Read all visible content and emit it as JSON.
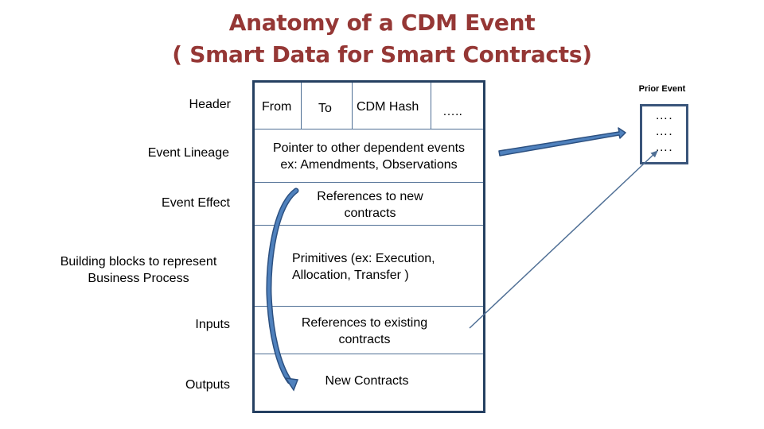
{
  "title": {
    "line1": "Anatomy of a CDM Event",
    "line2": "( Smart Data for Smart Contracts)",
    "color": "#953735"
  },
  "labels": {
    "header": "Header",
    "event_lineage": "Event Lineage",
    "event_effect": "Event Effect",
    "building_blocks_line1": "Building blocks to represent",
    "building_blocks_line2": "Business Process",
    "inputs": "Inputs",
    "outputs": "Outputs"
  },
  "event_box": {
    "header_cells": [
      "From",
      "To",
      "CDM Hash",
      "….."
    ],
    "lineage_line1": "Pointer to other dependent events",
    "lineage_line2": "ex: Amendments, Observations",
    "effect_line1": "References to new",
    "effect_line2": "contracts",
    "primitives_line1": "Primitives (ex: Execution,",
    "primitives_line2": "Allocation, Transfer )",
    "inputs_line1": "References to existing",
    "inputs_line2": "contracts",
    "outputs": "New Contracts",
    "border_color": "#254061"
  },
  "prior_event": {
    "title": "Prior Event",
    "rows": [
      "….",
      "….",
      "…."
    ]
  },
  "arrows": {
    "color": "#4f81bd"
  }
}
